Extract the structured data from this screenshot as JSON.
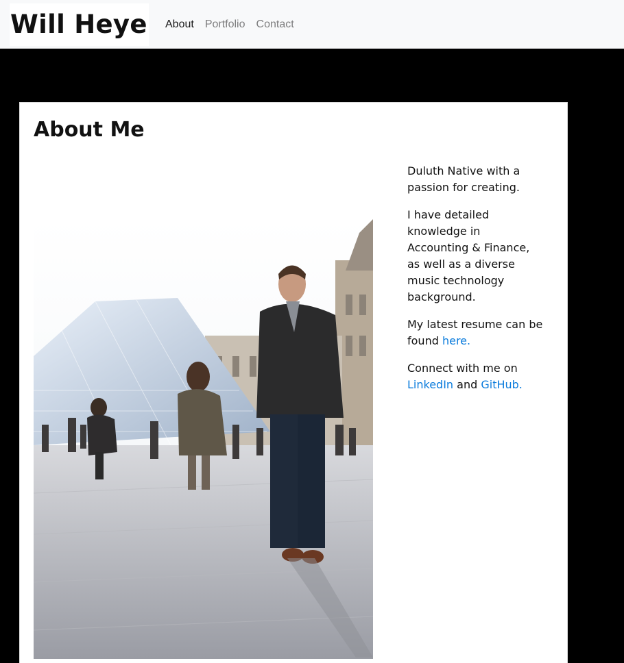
{
  "navbar": {
    "brand": "Will Heyer",
    "links": [
      {
        "label": "About",
        "active": true
      },
      {
        "label": "Portfolio",
        "active": false
      },
      {
        "label": "Contact",
        "active": false
      }
    ]
  },
  "about": {
    "title": "About Me",
    "photo_icon": "profile-photo",
    "bio": {
      "p1": "Duluth Native with a passion for creating.",
      "p2": "I have detailed knowledge in Accounting & Finance, as well as a diverse music technology background.",
      "p3_text": "My latest resume can be found ",
      "p3_link": "here.",
      "p4_text": "Connect with me on ",
      "p4_link1": "LinkedIn",
      "p4_and": " and ",
      "p4_link2": "GitHub."
    }
  },
  "colors": {
    "link": "#0a7bdc",
    "page_background": "#000000",
    "navbar_background": "#f8f9fa"
  }
}
